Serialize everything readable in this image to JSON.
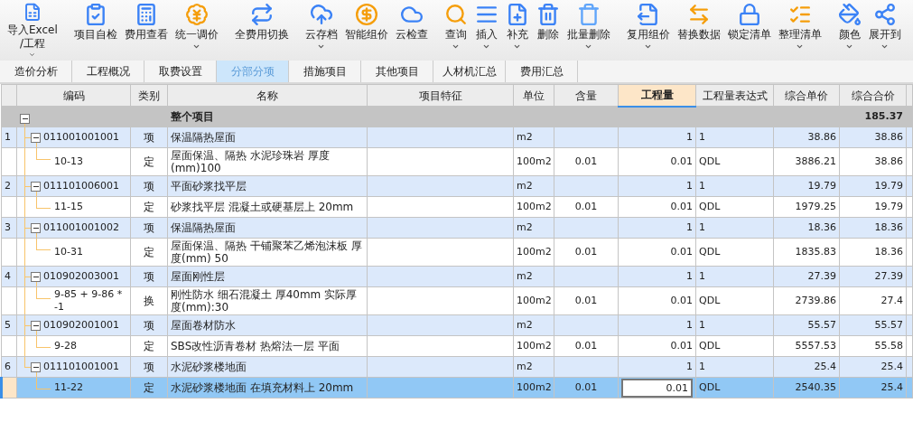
{
  "toolbar": [
    {
      "label": "导入Excel\n/工程",
      "dropdown": true
    },
    {
      "label": "项目自检",
      "dropdown": false
    },
    {
      "label": "费用查看",
      "dropdown": false
    },
    {
      "label": "统一调价",
      "dropdown": true
    },
    {
      "label": "全费用切换",
      "dropdown": false
    },
    {
      "label": "云存档",
      "dropdown": true
    },
    {
      "label": "智能组价",
      "dropdown": false
    },
    {
      "label": "云检查",
      "dropdown": false
    },
    {
      "label": "查询",
      "dropdown": true
    },
    {
      "label": "插入",
      "dropdown": true
    },
    {
      "label": "补充",
      "dropdown": true
    },
    {
      "label": "删除",
      "dropdown": false
    },
    {
      "label": "批量删除",
      "dropdown": true
    },
    {
      "label": "复用组价",
      "dropdown": true
    },
    {
      "label": "替换数据",
      "dropdown": false
    },
    {
      "label": "锁定清单",
      "dropdown": false
    },
    {
      "label": "整理清单",
      "dropdown": true
    },
    {
      "label": "颜色",
      "dropdown": true
    },
    {
      "label": "展开到",
      "dropdown": true
    }
  ],
  "tabs": [
    {
      "label": "造价分析",
      "selected": false
    },
    {
      "label": "工程概况",
      "selected": false
    },
    {
      "label": "取费设置",
      "selected": false
    },
    {
      "label": "分部分项",
      "selected": true
    },
    {
      "label": "措施项目",
      "selected": false
    },
    {
      "label": "其他项目",
      "selected": false
    },
    {
      "label": "人材机汇总",
      "selected": false
    },
    {
      "label": "费用汇总",
      "selected": false
    }
  ],
  "table": {
    "columns": [
      {
        "label": "编码",
        "selected": false
      },
      {
        "label": "类别",
        "selected": false
      },
      {
        "label": "名称",
        "selected": false
      },
      {
        "label": "项目特征",
        "selected": false
      },
      {
        "label": "单位",
        "selected": false
      },
      {
        "label": "含量",
        "selected": false
      },
      {
        "label": "工程量",
        "selected": true
      },
      {
        "label": "工程量表达式",
        "selected": false
      },
      {
        "label": "综合单价",
        "selected": false
      },
      {
        "label": "综合合价",
        "selected": false
      }
    ],
    "root": {
      "name": "整个项目",
      "total": "185.37",
      "expanded": true,
      "children": [
        {
          "no": "1",
          "code": "011001001001",
          "type": "项",
          "name": "保温隔热屋面",
          "unit": "m2",
          "qty": "1",
          "expr": "1",
          "unit_price": "38.86",
          "total": "38.86",
          "expanded": true,
          "selected": false,
          "children": [
            {
              "code": "10-13",
              "type": "定",
              "name": "屋面保温、隔热 水泥珍珠岩 厚度(mm)100",
              "unit": "100m2",
              "content": "0.01",
              "qty": "0.01",
              "expr": "QDL",
              "unit_price": "3886.21",
              "total": "38.86",
              "selected": false
            }
          ]
        },
        {
          "no": "2",
          "code": "011101006001",
          "type": "项",
          "name": "平面砂浆找平层",
          "unit": "m2",
          "qty": "1",
          "expr": "1",
          "unit_price": "19.79",
          "total": "19.79",
          "expanded": true,
          "selected": false,
          "children": [
            {
              "code": "11-15",
              "type": "定",
              "name": "砂浆找平层 混凝土或硬基层上 20mm",
              "unit": "100m2",
              "content": "0.01",
              "qty": "0.01",
              "expr": "QDL",
              "unit_price": "1979.25",
              "total": "19.79",
              "selected": false
            }
          ]
        },
        {
          "no": "3",
          "code": "011001001002",
          "type": "项",
          "name": "保温隔热屋面",
          "unit": "m2",
          "qty": "1",
          "expr": "1",
          "unit_price": "18.36",
          "total": "18.36",
          "expanded": true,
          "selected": false,
          "children": [
            {
              "code": "10-31",
              "type": "定",
              "name": "屋面保温、隔热 干铺聚苯乙烯泡沫板 厚度(mm) 50",
              "unit": "100m2",
              "content": "0.01",
              "qty": "0.01",
              "expr": "QDL",
              "unit_price": "1835.83",
              "total": "18.36",
              "selected": false
            }
          ]
        },
        {
          "no": "4",
          "code": "010902003001",
          "type": "项",
          "name": "屋面刚性层",
          "unit": "m2",
          "qty": "1",
          "expr": "1",
          "unit_price": "27.39",
          "total": "27.39",
          "expanded": true,
          "selected": false,
          "children": [
            {
              "code": "9-85 + 9-86 * -1",
              "type": "换",
              "name": "刚性防水 细石混凝土 厚40mm  实际厚度(mm):30",
              "unit": "100m2",
              "content": "0.01",
              "qty": "0.01",
              "expr": "QDL",
              "unit_price": "2739.86",
              "total": "27.4",
              "selected": false
            }
          ]
        },
        {
          "no": "5",
          "code": "010902001001",
          "type": "项",
          "name": "屋面卷材防水",
          "unit": "m2",
          "qty": "1",
          "expr": "1",
          "unit_price": "55.57",
          "total": "55.57",
          "expanded": true,
          "selected": false,
          "children": [
            {
              "code": "9-28",
              "type": "定",
              "name": "SBS改性沥青卷材 热熔法一层 平面",
              "unit": "100m2",
              "content": "0.01",
              "qty": "0.01",
              "expr": "QDL",
              "unit_price": "5557.53",
              "total": "55.58",
              "selected": false
            }
          ]
        },
        {
          "no": "6",
          "code": "011101001001",
          "type": "项",
          "name": "水泥砂浆楼地面",
          "unit": "m2",
          "qty": "1",
          "expr": "1",
          "unit_price": "25.4",
          "total": "25.4",
          "expanded": true,
          "selected": false,
          "children": [
            {
              "code": "11-22",
              "type": "定",
              "name": "水泥砂浆楼地面 在填充材料上 20mm",
              "unit": "100m2",
              "content": "0.01",
              "qty": "0.01",
              "expr": "QDL",
              "unit_price": "2540.35",
              "total": "25.4",
              "selected": true
            }
          ]
        }
      ]
    }
  }
}
